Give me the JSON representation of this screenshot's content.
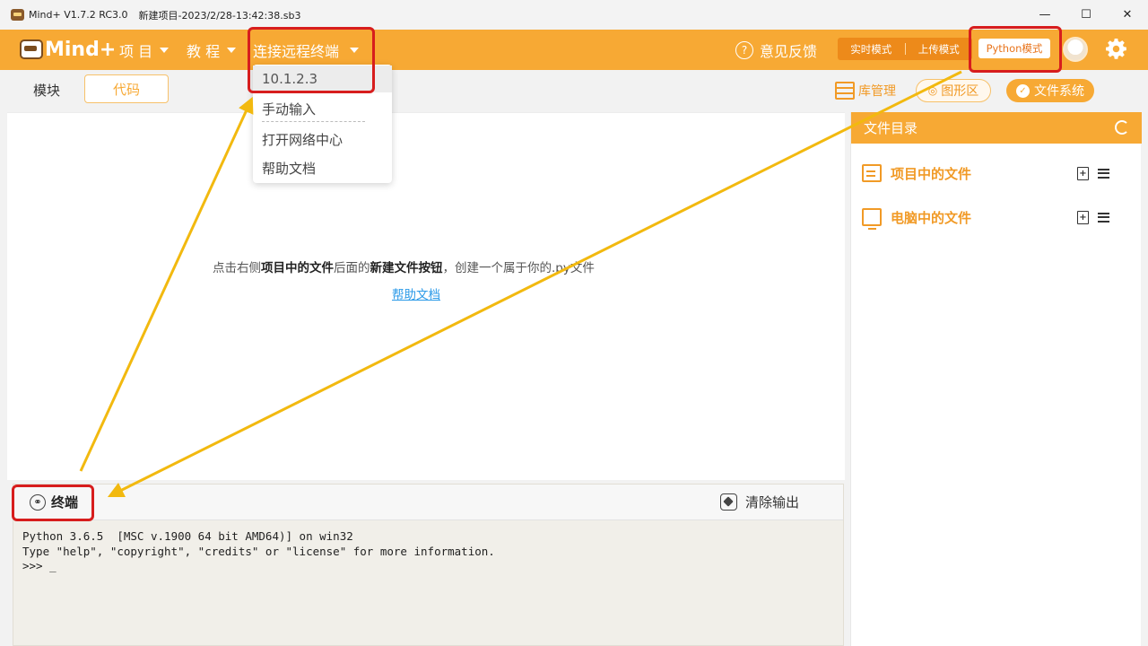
{
  "window": {
    "app_title": "Mind+ V1.7.2 RC3.0",
    "project_title": "新建项目-2023/2/28-13:42:38.sb3",
    "minimize": "—",
    "maximize": "☐",
    "close": "✕"
  },
  "menubar": {
    "logo_text": "Mind+",
    "project": "项 目",
    "tutorial": "教 程",
    "connect": "连接远程终端",
    "feedback": "意见反馈",
    "realtime_mode": "实时模式",
    "upload_mode": "上传模式",
    "python_mode": "Python模式"
  },
  "dropdown": {
    "items": [
      "10.1.2.3",
      "手动输入",
      "打开网络中心",
      "帮助文档"
    ]
  },
  "tabs": {
    "modules": "模块",
    "code": "代码"
  },
  "toolbar": {
    "library": "库管理",
    "graphics": "图形区",
    "filesystem": "文件系统"
  },
  "editor": {
    "hint_prefix": "点击右侧",
    "hint_bold1": "项目中的文件",
    "hint_middle": "后面的",
    "hint_bold2": "新建文件按钮",
    "hint_suffix": "，创建一个属于你的.py文件",
    "help_link": "帮助文档"
  },
  "terminal": {
    "title": "终端",
    "clear": "清除输出",
    "lines": [
      "Python 3.6.5  [MSC v.1900 64 bit AMD64)] on win32",
      "Type \"help\", \"copyright\", \"credits\" or \"license\" for more information.",
      ">>> _"
    ]
  },
  "file_panel": {
    "title": "文件目录",
    "project_files": "项目中的文件",
    "computer_files": "电脑中的文件"
  },
  "colors": {
    "brand_orange": "#f7a934",
    "annotation_red": "#d71d1d",
    "arrow_yellow": "#f2b90f"
  }
}
